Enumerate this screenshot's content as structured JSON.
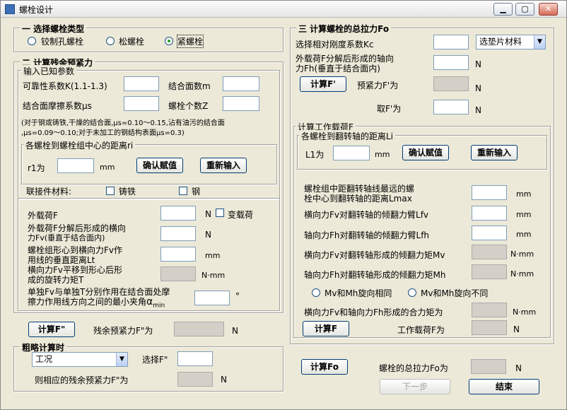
{
  "window": {
    "title": "螺栓设计",
    "minimize": "▁",
    "maximize": "▢",
    "close": "✕"
  },
  "section1": {
    "title": "一 选择螺栓类型",
    "options": [
      "铰制孔螺栓",
      "松螺栓",
      "紧螺栓"
    ],
    "selected": "紧螺栓"
  },
  "section2": {
    "title": "二 计算残余预紧力",
    "known": {
      "title": "输入已知参数",
      "k_label": "可靠性系数K(1.1-1.3)",
      "m_label": "结合面数m",
      "mu_label": "结合面摩擦系数μs",
      "z_label": "螺栓个数Z",
      "note_line1": "(对于钢或铸铁,干燥的结合面,μs=0.10～0.15,沾有油污的结合面",
      "note_line2": ",μs=0.09～0.10;对于未加工的钢结构表面μs=0.3)",
      "ri_group": {
        "title": "各螺栓到螺栓组中心的距离ri",
        "r1_label": "r1为",
        "unit": "mm",
        "confirm": "确认赋值",
        "reset": "重新输入"
      }
    },
    "material": {
      "label": "联接件材料:",
      "options": [
        "铸铁",
        "钢"
      ]
    },
    "loads": {
      "f_label": "外载荷F",
      "f_unit": "N",
      "variable_label": "变载荷",
      "fv_label_1": "外载荷F分解后形成的横向",
      "fv_label_2": "力Fv(垂直于结合面内)",
      "fv_unit": "N",
      "lt_label_1": "螺栓组形心到横向力Fv作",
      "lt_label_2": "用线的垂直距离Lt",
      "lt_unit": "mm",
      "t_label_1": "横向力Fv平移到形心后形",
      "t_label_2": "成的旋转力矩T",
      "t_unit": "N·mm",
      "alpha_label_1": "单独Fv与单独T分别作用在结合面处摩",
      "alpha_label_2": "擦力作用线方向之间的最小夹角",
      "alpha_symbol": "α",
      "alpha_sub": "min",
      "alpha_unit": "°"
    },
    "calc_f": "计算F\"",
    "residual_label": "残余预紧力F\"为",
    "residual_unit": "N"
  },
  "rough": {
    "title": "粗略计算时",
    "condition": "工况",
    "select_label": "选择F\"",
    "result_label": "则相应的残余预紧力F\"为",
    "result_unit": "N"
  },
  "section3": {
    "title": "三 计算螺栓的总拉力Fo",
    "kc_label": "选择相对刚度系数Kc",
    "gasket": "选垫片材料",
    "fh_label_1": "外载荷F分解后形成的轴向",
    "fh_label_2": "力Fh(垂直于结合面内)",
    "fh_unit": "N",
    "calc_fp": "计算F'",
    "preload_label": "预紧力F'为",
    "preload_unit": "N",
    "take_label": "取F'为",
    "take_unit": "N",
    "working": {
      "title": "计算工作载荷F",
      "li_group": {
        "title": "各螺栓到翻转轴的距离Li",
        "l1_label": "L1为",
        "unit": "mm",
        "confirm": "确认赋值",
        "reset": "重新输入"
      },
      "lmax_label_1": "螺栓组中距翻转轴线最远的螺",
      "lmax_label_2": "栓中心到翻转轴的距离Lmax",
      "lmax_unit": "mm",
      "lfv_label": "横向力Fv对翻转轴的倾翻力臂Lfv",
      "lfv_unit": "mm",
      "lfh_label": "轴向力Fh对翻转轴的倾翻力臂Lfh",
      "lfh_unit": "mm",
      "mv_label": "横向力Fv对翻转轴形成的倾翻力矩Mv",
      "mv_unit": "N·mm",
      "mh_label": "轴向力Fh对翻转轴形成的倾翻力矩Mh",
      "mh_unit": "N·mm",
      "direction_options": [
        "Mv和Mh旋向相同",
        "Mv和Mh旋向不同"
      ],
      "total_label": "横向力Fv和轴向力Fh形成的合力矩为",
      "total_unit": "N·mm",
      "calc_f": "计算F",
      "work_label": "工作载荷F为",
      "work_unit": "N"
    },
    "calc_fo": "计算Fo",
    "fo_label": "螺栓的总拉力Fo为",
    "fo_unit": "N",
    "next": "下一步",
    "finish": "结束"
  }
}
